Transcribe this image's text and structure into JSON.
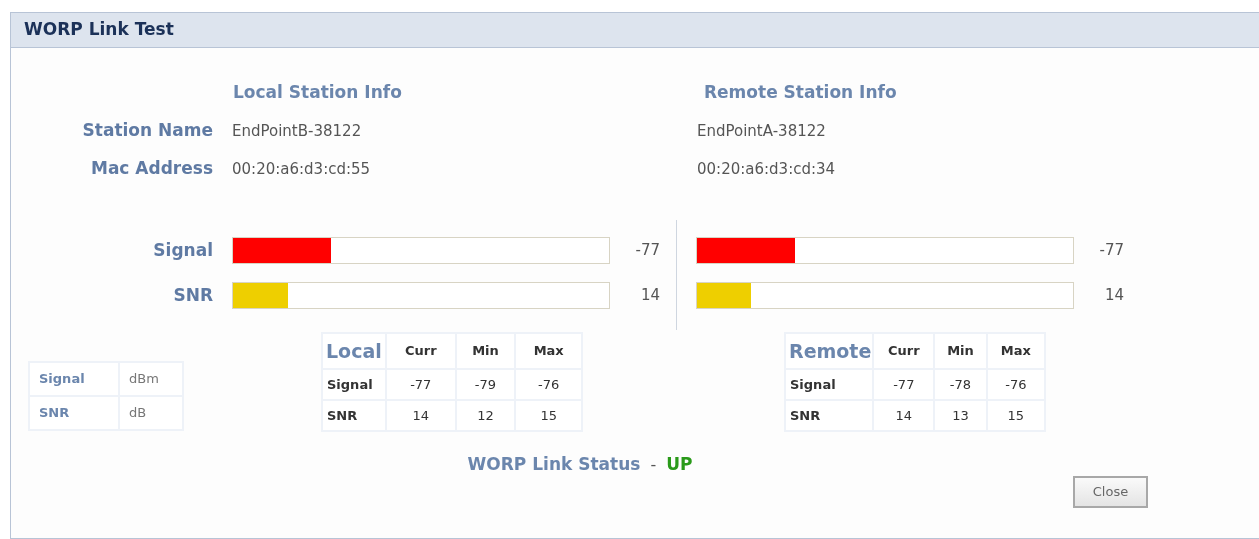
{
  "window": {
    "title": "WORP Link Test"
  },
  "station_info": {
    "columns": [
      "Local Station Info",
      "Remote Station Info"
    ],
    "rows": [
      {
        "label": "Station Name",
        "local": "EndPointB-38122",
        "remote": "EndPointA-38122"
      },
      {
        "label": "Mac Address",
        "local": "00:20:a6:d3:cd:55",
        "remote": "00:20:a6:d3:cd:34"
      }
    ]
  },
  "meters": [
    {
      "label": "Signal",
      "color": "#ff0000",
      "local": {
        "level": 0.26,
        "reading": "-77"
      },
      "remote": {
        "level": 0.26,
        "reading": "-77"
      }
    },
    {
      "label": "SNR",
      "color": "#eecf00",
      "local": {
        "level": 0.145,
        "reading": "14"
      },
      "remote": {
        "level": 0.143,
        "reading": "14"
      }
    }
  ],
  "units_legend": [
    {
      "name": "Signal",
      "unit": "dBm"
    },
    {
      "name": "SNR",
      "unit": "dB"
    }
  ],
  "stats_tables": [
    {
      "title": "Local",
      "columns": [
        "Curr",
        "Min",
        "Max"
      ],
      "rows": [
        {
          "label": "Signal",
          "values": [
            "-77",
            "-79",
            "-76"
          ]
        },
        {
          "label": "SNR",
          "values": [
            "14",
            "12",
            "15"
          ]
        }
      ]
    },
    {
      "title": "Remote",
      "columns": [
        "Curr",
        "Min",
        "Max"
      ],
      "rows": [
        {
          "label": "Signal",
          "values": [
            "-77",
            "-78",
            "-76"
          ]
        },
        {
          "label": "SNR",
          "values": [
            "14",
            "13",
            "15"
          ]
        }
      ]
    }
  ],
  "link_status": {
    "label": "WORP Link Status",
    "separator": "-",
    "value": "UP"
  },
  "buttons": [
    {
      "label": "Close"
    }
  ]
}
